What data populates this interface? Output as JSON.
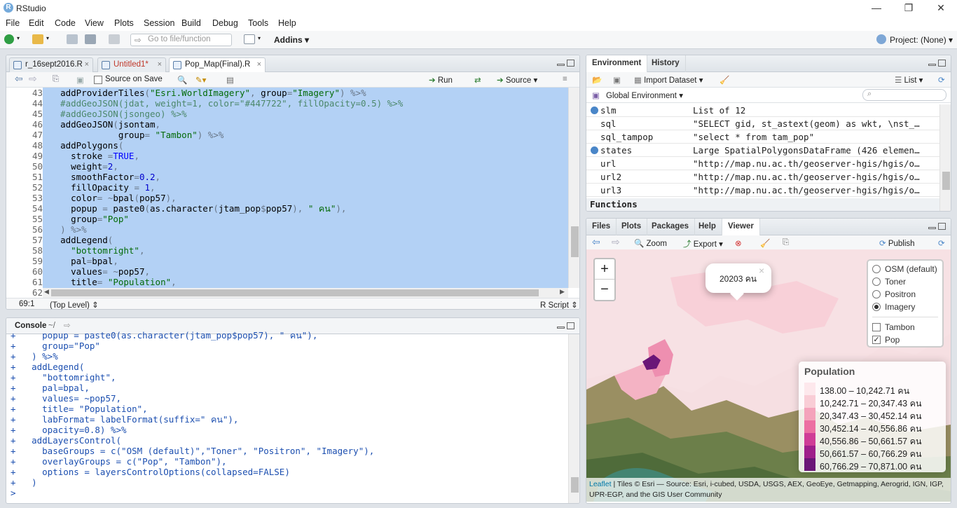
{
  "window": {
    "title": "RStudio",
    "app_icon_letter": "R"
  },
  "menu": [
    "File",
    "Edit",
    "Code",
    "View",
    "Plots",
    "Session",
    "Build",
    "Debug",
    "Tools",
    "Help"
  ],
  "toolbar": {
    "goto_placeholder": "Go to file/function",
    "addins": "Addins",
    "project": "Project: (None)"
  },
  "editor": {
    "tabs": [
      {
        "label": "r_16sept2016.R",
        "modified": false
      },
      {
        "label": "Untitled1*",
        "modified": true
      },
      {
        "label": "Pop_Map(Final).R",
        "active": true
      }
    ],
    "source_on_save": "Source on Save",
    "run": "Run",
    "source": "Source",
    "line_numbers": [
      "43",
      "44",
      "45",
      "46",
      "47",
      "48",
      "49",
      "50",
      "51",
      "52",
      "53",
      "54",
      "55",
      "56",
      "57",
      "58",
      "59",
      "60",
      "61",
      "62"
    ],
    "lines": [
      "  addProviderTiles(\"Esri.WorldImagery\", group=\"Imagery\") %>%",
      "  #addGeoJSON(jdat, weight=1, color=\"#447722\", fillOpacity=0.5) %>%",
      "  #addGeoJSON(jsongeo) %>%",
      "  addGeoJSON(jsontam,",
      "             group= \"Tambon\") %>%",
      "  addPolygons(",
      "    stroke =TRUE,",
      "    weight=2,",
      "    smoothFactor=0.2,",
      "    fillOpacity = 1,",
      "    color= ~bpal(pop57),",
      "    popup = paste0(as.character(jtam_pop$pop57), \" คน\"),",
      "    group=\"Pop\"",
      "  ) %>%",
      "  addLegend(",
      "    \"bottomright\",",
      "    pal=bpal,",
      "    values= ~pop57,",
      "    title= \"Population\",",
      ""
    ],
    "status_pos": "69:1",
    "status_scope": "(Top Level)",
    "status_type": "R Script"
  },
  "console": {
    "title": "Console",
    "path": "~/",
    "lines": [
      "+     popup = paste0(as.character(jtam_pop$pop57), \" คน\"),",
      "+     group=\"Pop\"",
      "+   ) %>%",
      "+   addLegend(",
      "+     \"bottomright\",",
      "+     pal=bpal,",
      "+     values= ~pop57,",
      "+     title= \"Population\",",
      "+     labFormat= labelFormat(suffix=\" คน\"),",
      "+     opacity=0.8) %>%",
      "+   addLayersControl(",
      "+     baseGroups = c(\"OSM (default)\",\"Toner\", \"Positron\", \"Imagery\"),",
      "+     overlayGroups = c(\"Pop\", \"Tambon\"),",
      "+     options = layersControlOptions(collapsed=FALSE)",
      "+   )",
      ">"
    ]
  },
  "environment": {
    "tabs": [
      "Environment",
      "History"
    ],
    "import_dataset": "Import Dataset",
    "view_mode": "List",
    "scope": "Global Environment",
    "search_placeholder": "",
    "rows": [
      {
        "name": "slm",
        "value": "List of 12",
        "expandable": true
      },
      {
        "name": "sql",
        "value": "\"SELECT gid, st_astext(geom) as wkt, \\nst_…",
        "expandable": false
      },
      {
        "name": "sql_tampop",
        "value": "\"select * from tam_pop\"",
        "expandable": false
      },
      {
        "name": "states",
        "value": "Large SpatialPolygonsDataFrame (426 elemen…",
        "expandable": true
      },
      {
        "name": "url",
        "value": "\"http://map.nu.ac.th/geoserver-hgis/hgis/o…",
        "expandable": false
      },
      {
        "name": "url2",
        "value": "\"http://map.nu.ac.th/geoserver-hgis/hgis/o…",
        "expandable": false
      },
      {
        "name": "url3",
        "value": "\"http://map.nu.ac.th/geoserver-hgis/hgis/o…",
        "expandable": false
      }
    ],
    "section": "Functions"
  },
  "viewer": {
    "tabs": [
      "Files",
      "Plots",
      "Packages",
      "Help",
      "Viewer"
    ],
    "active_tab": "Viewer",
    "zoom": "Zoom",
    "export": "Export",
    "publish": "Publish",
    "map": {
      "zoom_in": "+",
      "zoom_out": "−",
      "popup_text": "20203 คน",
      "popup_close": "×",
      "base_layers": [
        {
          "label": "OSM (default)",
          "selected": false
        },
        {
          "label": "Toner",
          "selected": false
        },
        {
          "label": "Positron",
          "selected": false
        },
        {
          "label": "Imagery",
          "selected": true
        }
      ],
      "overlays": [
        {
          "label": "Tambon",
          "checked": false
        },
        {
          "label": "Pop",
          "checked": true
        }
      ],
      "legend_title": "Population",
      "legend": [
        {
          "label": "138.00 – 10,242.71 คน",
          "color": "#fde8ec"
        },
        {
          "label": "10,242.71 – 20,347.43 คน",
          "color": "#f9cdd6"
        },
        {
          "label": "20,347.43 – 30,452.14 คน",
          "color": "#f4a3bb"
        },
        {
          "label": "30,452.14 – 40,556.86 คน",
          "color": "#ec6fa2"
        },
        {
          "label": "40,556.86 – 50,661.57 คน",
          "color": "#cf3d96"
        },
        {
          "label": "50,661.57 – 60,766.29 คน",
          "color": "#9e1f8a"
        },
        {
          "label": "60,766.29 – 70,871.00 คน",
          "color": "#6a1677"
        }
      ],
      "attribution_link": "Leaflet",
      "attribution": " | Tiles © Esri — Source: Esri, i-cubed, USDA, USGS, AEX, GeoEye, Getmapping, Aerogrid, IGN, IGP, UPR-EGP, and the GIS User Community"
    }
  },
  "colors": {
    "selection": "#b3d1f5",
    "accent": "#4a86c8"
  }
}
